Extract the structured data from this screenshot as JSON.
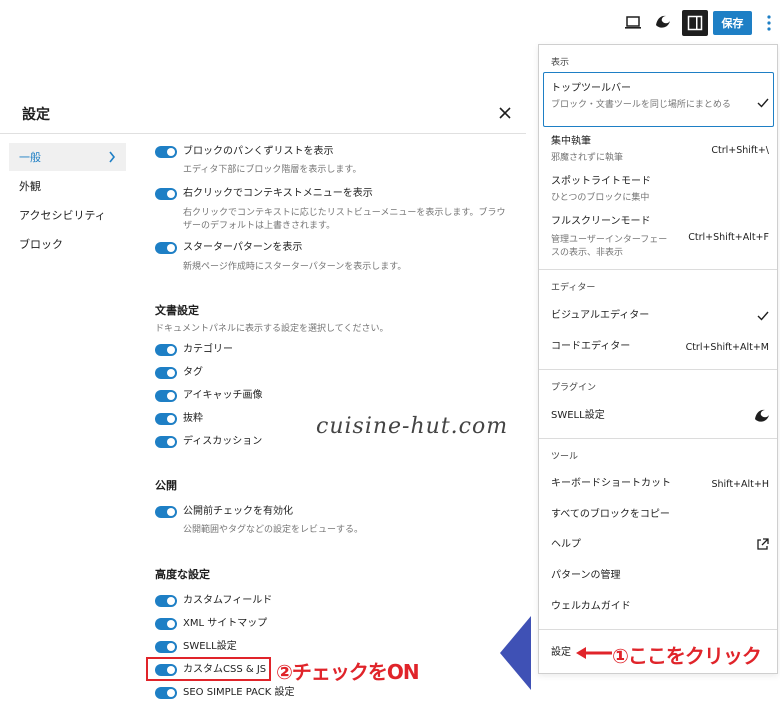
{
  "toolbar": {
    "save_label": "保存",
    "icons": [
      "laptop-icon",
      "swell-icon",
      "sidebar-toggle-icon",
      "kebab-menu-icon"
    ]
  },
  "modal": {
    "title": "設定",
    "nav": [
      {
        "label": "一般",
        "active": true
      },
      {
        "label": "外観"
      },
      {
        "label": "アクセシビリティ"
      },
      {
        "label": "ブロック"
      }
    ],
    "general_options": [
      {
        "label": "ブロックのパンくずリストを表示",
        "help": "エディタ下部にブロック階層を表示します。"
      },
      {
        "label": "右クリックでコンテキストメニューを表示",
        "help": "右クリックでコンテキストに応じたリストビューメニューを表示します。ブラウザーのデフォルトは上書きされます。"
      },
      {
        "label": "スターターパターンを表示",
        "help": "新規ページ作成時にスターターパターンを表示します。"
      }
    ],
    "document_settings": {
      "heading": "文書設定",
      "help": "ドキュメントパネルに表示する設定を選択してください。",
      "options": [
        "カテゴリー",
        "タグ",
        "アイキャッチ画像",
        "抜粋",
        "ディスカッション"
      ]
    },
    "publish": {
      "heading": "公開",
      "option": "公開前チェックを有効化",
      "help": "公開範囲やタグなどの設定をレビューする。"
    },
    "advanced": {
      "heading": "高度な設定",
      "options": [
        "カスタムフィールド",
        "XML サイトマップ",
        "SWELL設定",
        "カスタムCSS & JS",
        "SEO SIMPLE PACK 設定"
      ]
    }
  },
  "watermark": "cuisine-hut.com",
  "annotations": {
    "step1": "①ここをクリック",
    "step2": "②チェックをON",
    "accent": "#e0242a"
  },
  "menu": {
    "view_label": "表示",
    "top_toolbar": {
      "label": "トップツールバー",
      "help": "ブロック・文書ツールを同じ場所にまとめる",
      "checked": true
    },
    "spotlight_focus": {
      "label": "集中執筆",
      "help": "邪魔されずに執筆",
      "shortcut": "Ctrl+Shift+\\"
    },
    "spotlight_mode": {
      "label": "スポットライトモード",
      "help": "ひとつのブロックに集中"
    },
    "fullscreen": {
      "label": "フルスクリーンモード",
      "help1": "管理ユーザーインターフェー",
      "help2": "スの表示、非表示",
      "shortcut": "Ctrl+Shift+Alt+F"
    },
    "editor_label": "エディター",
    "visual_editor": {
      "label": "ビジュアルエディター",
      "checked": true
    },
    "code_editor": {
      "label": "コードエディター",
      "shortcut": "Ctrl+Shift+Alt+M"
    },
    "plugins_label": "プラグイン",
    "swell_settings": {
      "label": "SWELL設定"
    },
    "tools_label": "ツール",
    "keyboard_shortcuts": {
      "label": "キーボードショートカット",
      "shortcut": "Shift+Alt+H"
    },
    "copy_all_blocks": {
      "label": "すべてのブロックをコピー"
    },
    "help": {
      "label": "ヘルプ"
    },
    "manage_patterns": {
      "label": "パターンの管理"
    },
    "welcome_guide": {
      "label": "ウェルカムガイド"
    },
    "preferences": {
      "label": "設定"
    }
  },
  "colors": {
    "accent_blue": "#1e7fc5",
    "annotation_red": "#e0242a",
    "arrow_blue": "#3f51b5"
  }
}
